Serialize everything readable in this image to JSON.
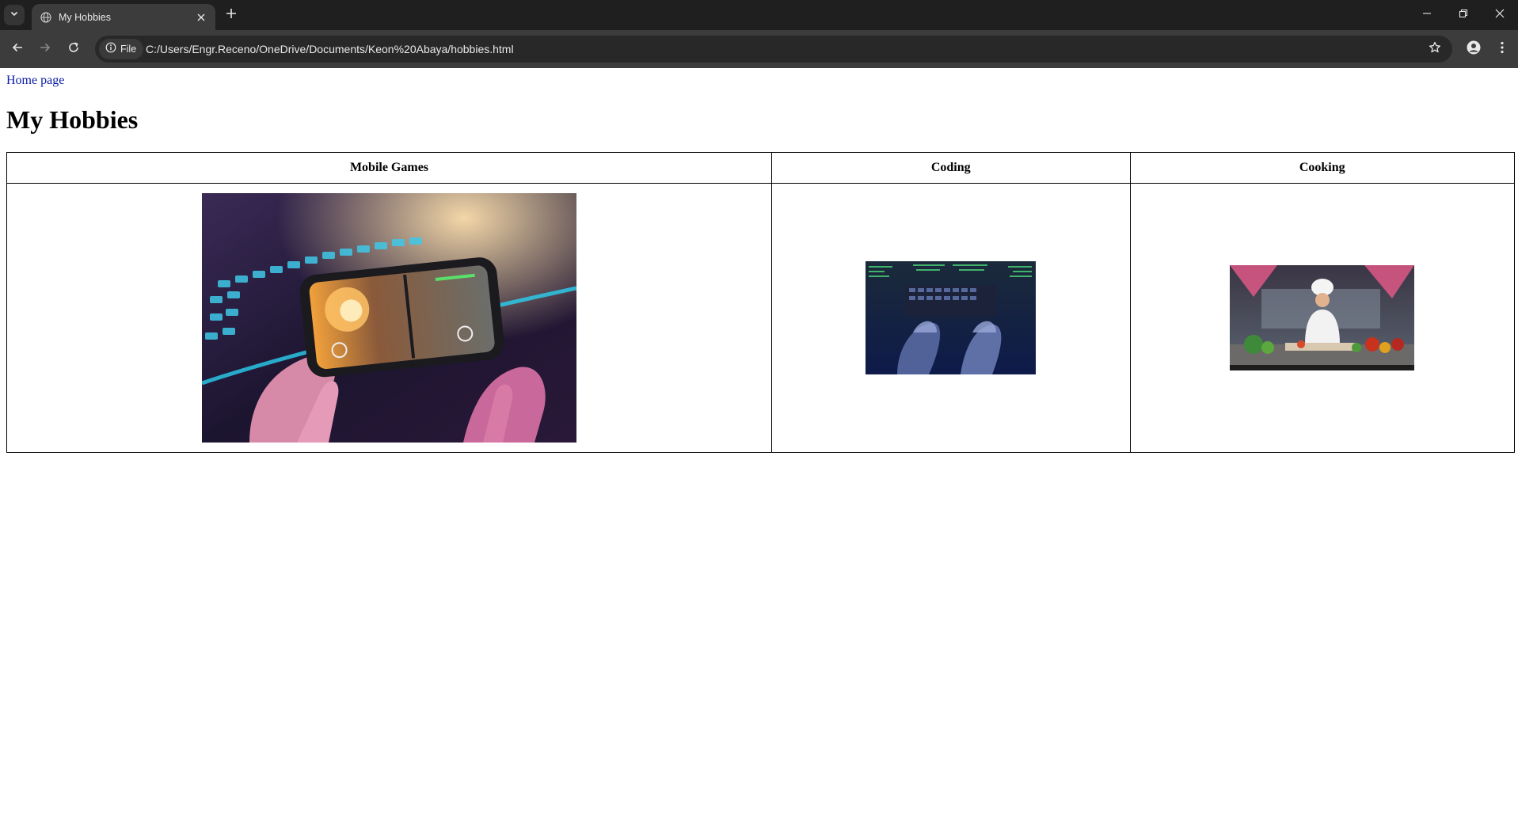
{
  "browser": {
    "tab": {
      "title": "My Hobbies"
    },
    "omnibox": {
      "chip_label": "File",
      "url": "C:/Users/Engr.Receno/OneDrive/Documents/Keon%20Abaya/hobbies.html"
    },
    "icons": {
      "tab_search": "chevron-down-icon",
      "favicon": "globe-icon",
      "tab_close": "close-icon",
      "new_tab": "plus-icon",
      "back": "arrow-left-icon",
      "forward": "arrow-right-icon",
      "reload": "reload-icon",
      "site_info": "info-icon",
      "bookmark": "star-icon",
      "profile": "person-icon",
      "menu": "kebab-menu-icon",
      "minimize": "minimize-icon",
      "restore": "restore-icon",
      "close_window": "close-icon"
    },
    "colors": {
      "tabstrip": "#1f1f1f",
      "toolbar": "#3c3c3c",
      "omnibox": "#282828"
    }
  },
  "page": {
    "home_link": "Home page",
    "title": "My Hobbies",
    "table": {
      "headers": [
        "Mobile Games",
        "Coding",
        "Cooking"
      ],
      "images": [
        {
          "subject": "hands holding a smartphone playing an action game in front of a backlit keyboard"
        },
        {
          "subject": "hands typing on a keyboard surrounded by screens of green code"
        },
        {
          "subject": "chef in white uniform preparing vegetables in a professional kitchen"
        }
      ]
    },
    "link_color": "#0b1ca6"
  }
}
